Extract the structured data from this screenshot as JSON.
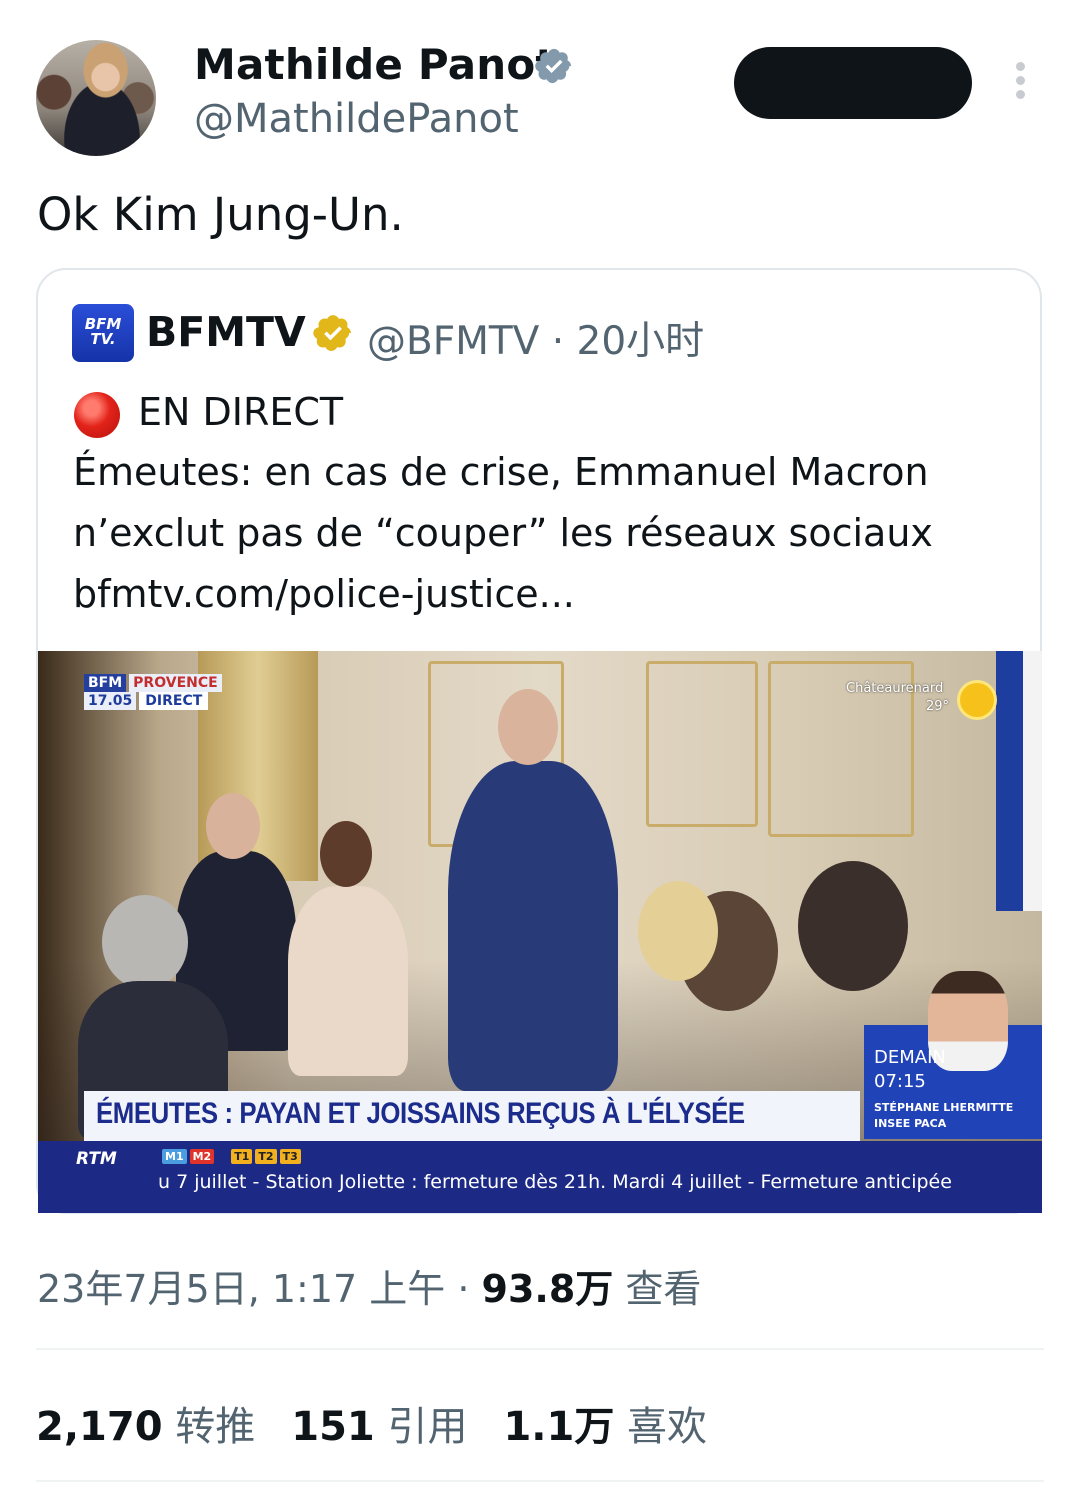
{
  "author": {
    "name": "Mathilde Panot",
    "handle": "@MathildePanot"
  },
  "tweet": {
    "text": "Ok Kim Jung-Un."
  },
  "quote": {
    "logo_text_1": "BFM",
    "logo_text_2": "TV.",
    "name": "BFMTV",
    "handle_time": "@BFMTV · 20小时",
    "live_label": "EN DIRECT",
    "line1": "Émeutes: en cas de crise, Emmanuel Macron",
    "line2": "n’exclut pas de “couper” les réseaux sociaux",
    "link": "bfmtv.com/police-justice...",
    "media": {
      "channel": "BFM",
      "region": "PROVENCE",
      "time": "17.05",
      "direct": "DIRECT",
      "weather_city": "Châteaurenard",
      "weather_temp": "29°",
      "headline": "ÉMEUTES : PAYAN ET JOISSAINS REÇUS À L'ÉLYSÉE",
      "demain": "DEMAIN",
      "demain_time": "07:15",
      "guest_name": "STÉPHANE LHERMITTE",
      "guest_org": "INSEE PACA",
      "ticker_brand": "RTM",
      "metro_lines": [
        "M1",
        "M2",
        "T1",
        "T2",
        "T3"
      ],
      "ticker": "u 7 juillet - Station Joliette : fermeture dès 21h.     Mardi 4 juillet - Fermeture anticipée"
    }
  },
  "meta": {
    "datetime": "23年7月5日, 1:17 上午 · ",
    "views_count": "93.8万",
    "views_label": " 查看"
  },
  "stats": {
    "retweets_count": "2,170",
    "retweets_label": " 转推",
    "quotes_count": "151",
    "quotes_label": " 引用",
    "likes_count": "1.1万",
    "likes_label": " 喜欢"
  },
  "colors": {
    "verified_blue": "#829aab",
    "verified_gold": "#e2b719",
    "muted": "#536471",
    "bfm_blue": "#1d3c9b"
  }
}
